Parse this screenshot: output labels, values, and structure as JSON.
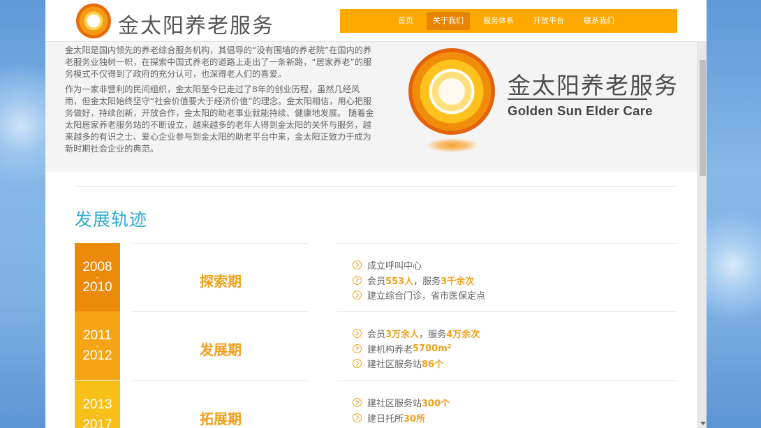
{
  "header": {
    "logo_text": "金太阳养老服务",
    "nav": [
      "首页",
      "关于我们",
      "服务体系",
      "开放平台",
      "联系我们"
    ],
    "nav_active": 1
  },
  "intro": {
    "paragraphs": [
      "金太阳是国内领先的养老综合服务机构，其倡导的“没有围墙的养老院”在国内的养老服务业独树一帜，在探索中国式养老的道路上走出了一条新路，“居家养老”的服务模式不仅得到了政府的充分认可，也深得老人们的喜爱。",
      "作为一家非营利的民间组织，金太阳至今已走过了8年的创业历程，虽然几经风雨，但金太阳始终坚守“社会价值要大于经济价值”的理念。金太阳相信，用心把服务做好，持续创新，开放合作，金太阳的助老事业就能持续、健康地发展。 随着金太阳居家养老服务站的不断设立，越来越多的老年人得到金太阳的关怀与服务，越来越多的有识之士、爱心企业参与到金太阳的助老平台中来，金太阳正致力于成为新时期社会企业的典范。"
    ],
    "brand_cn": "金太阳养老服务",
    "brand_en": "Golden Sun Elder Care"
  },
  "section_title": "发展轨迹",
  "timeline": [
    {
      "year_start": "2008",
      "dash": "-",
      "year_end": "2010",
      "phase": "探索期",
      "color": "#ec8a0b",
      "items": [
        [
          {
            "t": "成立呼叫中心"
          }
        ],
        [
          {
            "t": "会员"
          },
          {
            "t": "553人",
            "h": true
          },
          {
            "t": "，服务"
          },
          {
            "t": "3千余次",
            "h": true
          }
        ],
        [
          {
            "t": "建立综合门诊，省市医保定点"
          }
        ]
      ]
    },
    {
      "year_start": "2011",
      "dash": "-",
      "year_end": "2012",
      "phase": "发展期",
      "color": "#f5a414",
      "items": [
        [
          {
            "t": "会员"
          },
          {
            "t": "3万余人",
            "h": true
          },
          {
            "t": "，服务"
          },
          {
            "t": "4万余次",
            "h": true
          }
        ],
        [
          {
            "t": "建机构养老"
          },
          {
            "t": "5700m²",
            "h": true
          }
        ],
        [
          {
            "t": "建社区服务站"
          },
          {
            "t": "86个",
            "h": true
          }
        ]
      ]
    },
    {
      "year_start": "2013",
      "dash": "-",
      "year_end": "2017",
      "phase": "拓展期",
      "color": "#f8bf18",
      "items": [
        [
          {
            "t": "建社区服务站"
          },
          {
            "t": "300个",
            "h": true
          }
        ],
        [
          {
            "t": "建日托所"
          },
          {
            "t": "30所",
            "h": true
          }
        ]
      ]
    }
  ]
}
